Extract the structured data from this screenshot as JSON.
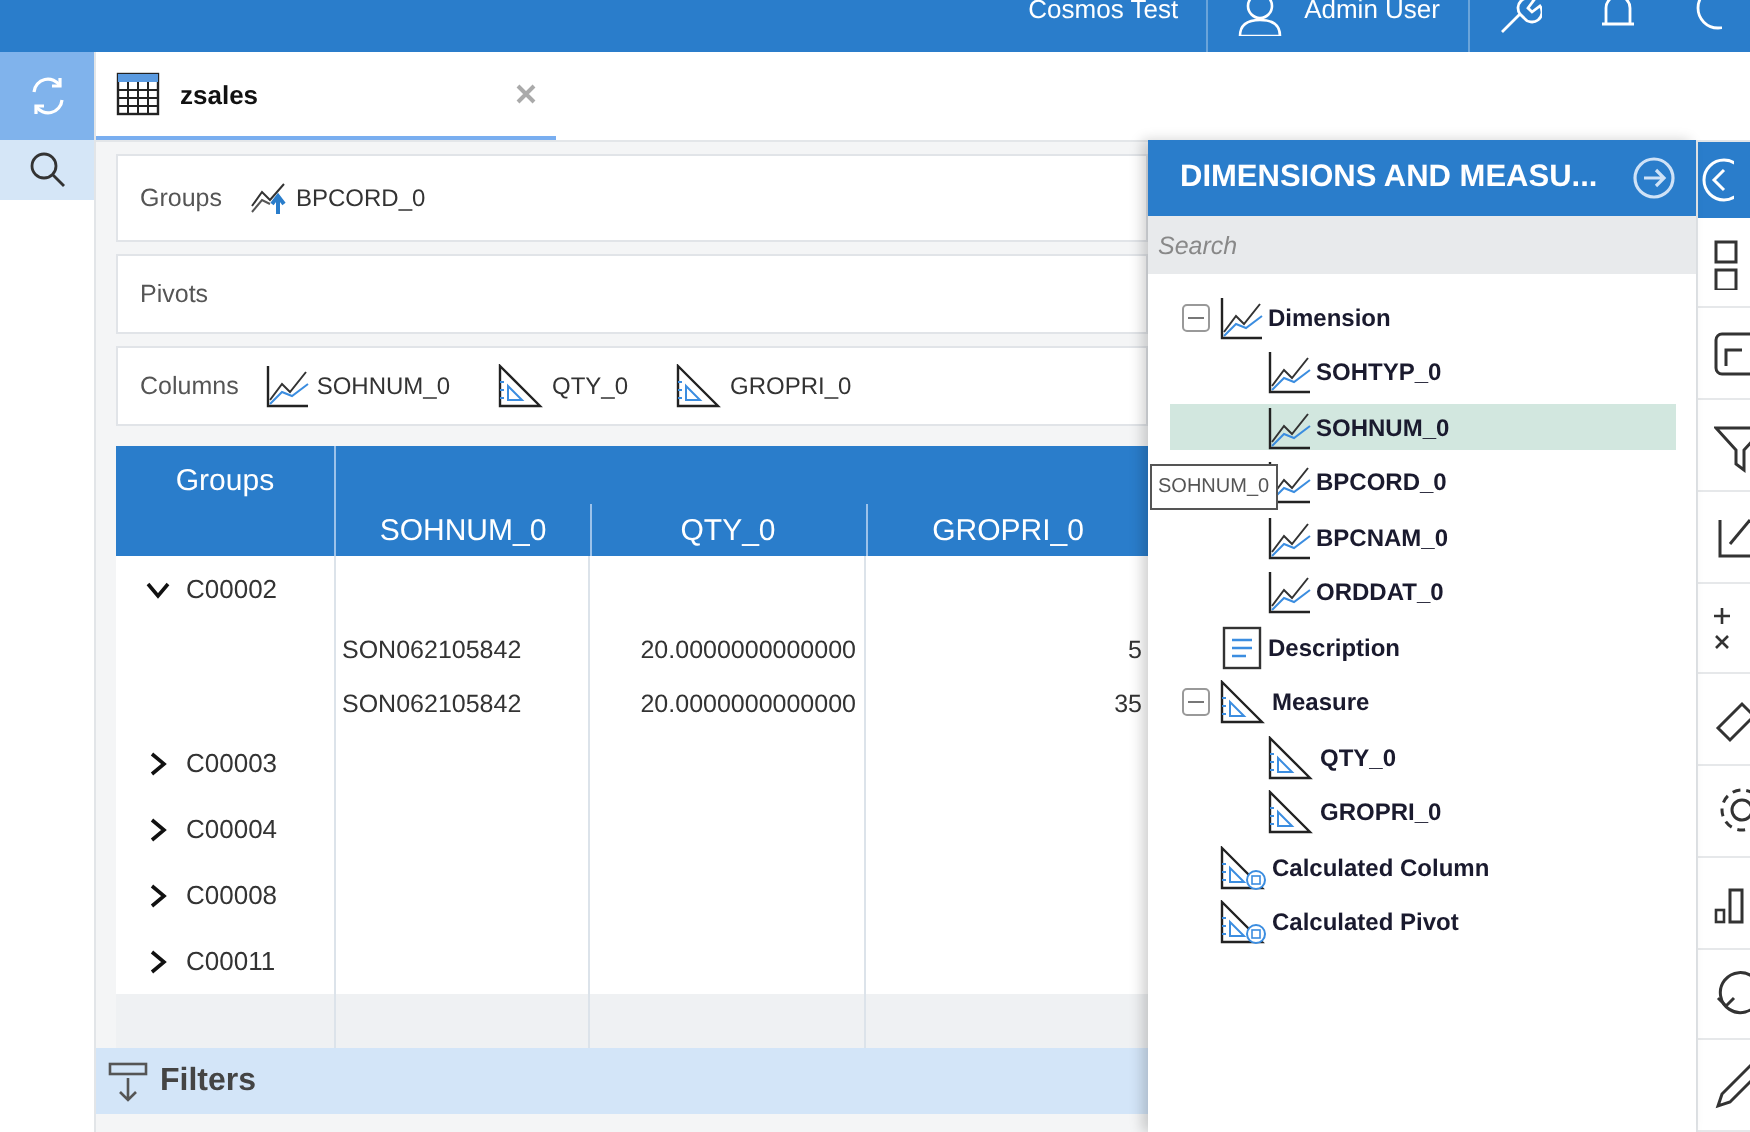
{
  "topbar": {
    "company": "Cosmos Test",
    "user": "Admin User"
  },
  "tab": {
    "title": "zsales",
    "selected": true
  },
  "zones": [
    {
      "label": "Groups",
      "fields": [
        {
          "name": "BPCORD_0",
          "kind": "group"
        }
      ]
    },
    {
      "label": "Pivots"
    },
    {
      "label": "Columns",
      "fields": [
        {
          "name": "SOHNUM_0",
          "kind": "dimension"
        },
        {
          "name": "QTY_0",
          "kind": "measure"
        },
        {
          "name": "GROPRI_0",
          "kind": "measure"
        }
      ]
    }
  ],
  "table": {
    "group_header": "Groups",
    "columns": [
      "SOHNUM_0",
      "QTY_0",
      "GROPRI_0"
    ],
    "groups": [
      {
        "name": "C00002",
        "expanded": true,
        "rows": [
          [
            "SON062105842",
            "20.0000000000000",
            "5"
          ],
          [
            "SON062105842",
            "20.0000000000000",
            "35"
          ]
        ]
      },
      {
        "name": "C00003",
        "expanded": false
      },
      {
        "name": "C00004",
        "expanded": false
      },
      {
        "name": "C00008",
        "expanded": false
      },
      {
        "name": "C00011",
        "expanded": false
      }
    ]
  },
  "filters": {
    "label": "Filters"
  },
  "drawer": {
    "title": "DIMENSIONS AND MEASU...",
    "search": {
      "placeholder": "Search"
    },
    "tree": [
      {
        "label": "Dimension",
        "kind": "dimension",
        "selected": false,
        "expanded": true,
        "children": [
          {
            "label": "SOHTYP_0",
            "kind": "dimension",
            "selected": false
          },
          {
            "label": "SOHNUM_0",
            "kind": "dimension",
            "selected": true
          },
          {
            "label": "BPCORD_0",
            "kind": "dimension",
            "selected": false
          },
          {
            "label": "BPCNAM_0",
            "kind": "dimension",
            "selected": false
          },
          {
            "label": "ORDDAT_0",
            "kind": "dimension",
            "selected": false
          }
        ]
      },
      {
        "label": "Description",
        "kind": "description",
        "selected": false
      },
      {
        "label": "Measure",
        "kind": "measure",
        "selected": false,
        "expanded": true,
        "children": [
          {
            "label": "QTY_0",
            "kind": "measure",
            "selected": false
          },
          {
            "label": "GROPRI_0",
            "kind": "measure",
            "selected": false
          }
        ]
      },
      {
        "label": "Calculated Column",
        "kind": "calc-column",
        "selected": false
      },
      {
        "label": "Calculated Pivot",
        "kind": "calc-pivot",
        "selected": false
      }
    ],
    "tooltip": "SOHNUM_0"
  }
}
